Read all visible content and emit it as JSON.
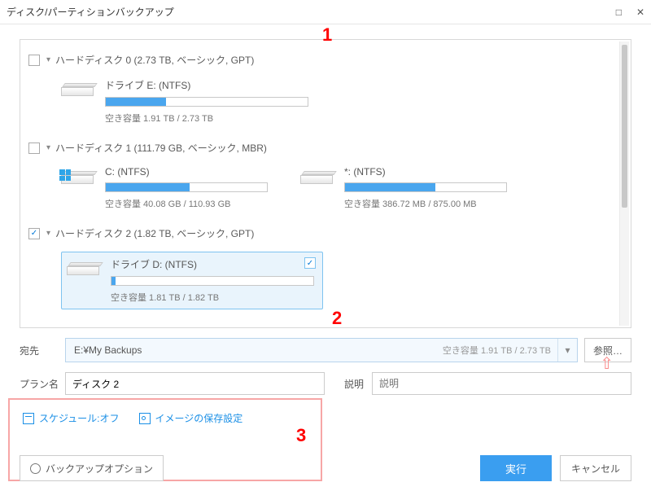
{
  "window": {
    "title": "ディスク/パーティションバックアップ"
  },
  "annotations": {
    "n1": "1",
    "n2": "2",
    "n3": "3"
  },
  "disks": [
    {
      "header": "ハードディスク 0 (2.73 TB, ベーシック, GPT)",
      "checked": false,
      "partitions": [
        {
          "name": "ドライブ E: (NTFS)",
          "free": "空き容量 1.91 TB / 2.73 TB",
          "fill_pct": 30,
          "icon": "hdd"
        }
      ]
    },
    {
      "header": "ハードディスク 1 (111.79 GB, ベーシック, MBR)",
      "checked": false,
      "partitions": [
        {
          "name": "C: (NTFS)",
          "free": "空き容量 40.08 GB / 110.93 GB",
          "fill_pct": 52,
          "icon": "windows"
        },
        {
          "name": "*: (NTFS)",
          "free": "空き容量 386.72 MB / 875.00 MB",
          "fill_pct": 56,
          "icon": "hdd"
        }
      ]
    },
    {
      "header": "ハードディスク 2 (1.82 TB, ベーシック, GPT)",
      "checked": true,
      "partitions": [
        {
          "name": "ドライブ D: (NTFS)",
          "free": "空き容量 1.81 TB / 1.82 TB",
          "fill_pct": 2,
          "icon": "hdd",
          "selected": true
        }
      ]
    }
  ],
  "destination": {
    "label": "宛先",
    "path": "E:¥My Backups",
    "free": "空き容量 1.91 TB / 2.73 TB",
    "browse": "参照…"
  },
  "plan": {
    "label": "プラン名",
    "value": "ディスク 2",
    "desc_label": "説明",
    "desc_placeholder": "説明"
  },
  "links": {
    "schedule": "スケジュール:オフ",
    "image_settings": "イメージの保存設定"
  },
  "buttons": {
    "options": "バックアップオプション",
    "run": "実行",
    "cancel": "キャンセル"
  }
}
